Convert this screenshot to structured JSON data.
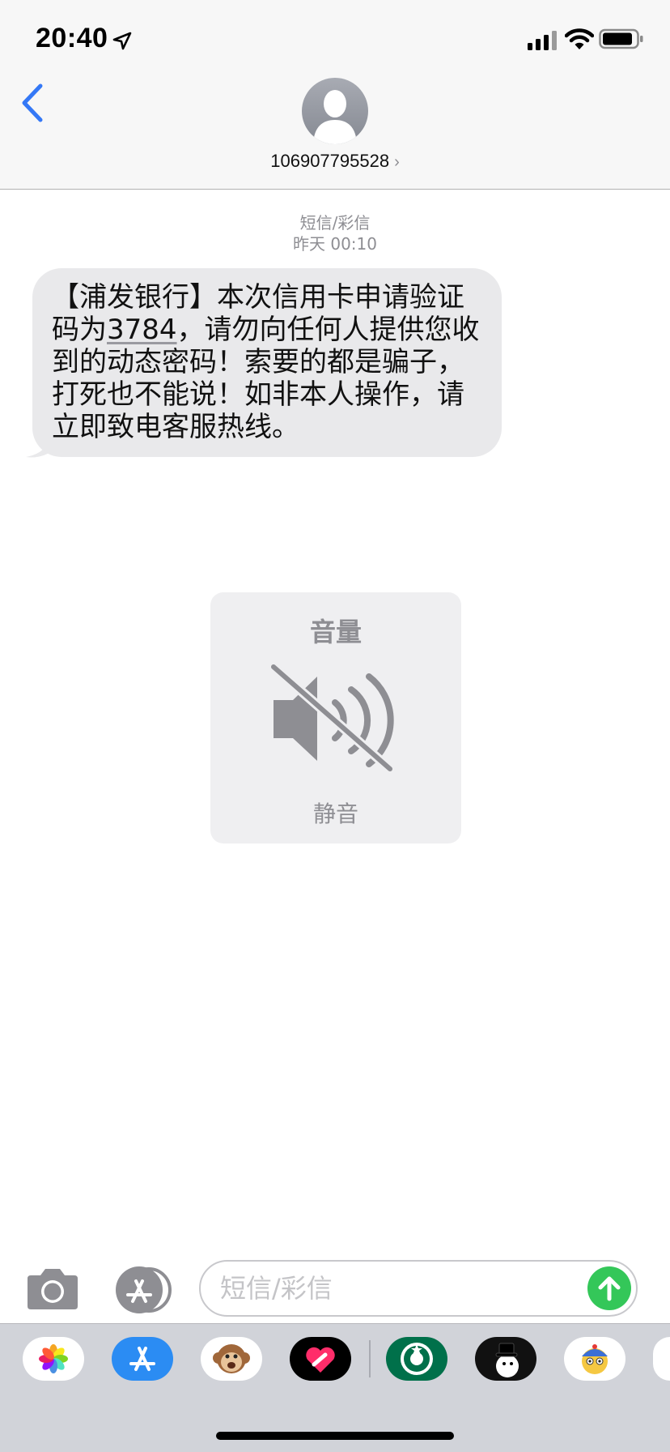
{
  "status_bar": {
    "time": "20:40",
    "icons": [
      "location-arrow-icon",
      "cellular-signal-icon",
      "wifi-icon",
      "battery-icon"
    ]
  },
  "header": {
    "back_icon": "chevron-left-icon",
    "avatar_icon": "person-silhouette-icon",
    "contact": "106907795528",
    "contact_chevron": "›"
  },
  "conversation": {
    "message_type": "短信/彩信",
    "timestamp": "昨天 00:10",
    "message": {
      "line1": "【浦发银行】本次信用卡申请验证",
      "line2_prefix": "码为",
      "code": "3784",
      "line2_suffix": "，请勿向任何人提供您收",
      "line3": "到的动态密码！索要的都是骗子，",
      "line4": "打死也不能说！如非本人操作，请",
      "line5": "立即致电客服热线。"
    }
  },
  "volume_hud": {
    "title": "音量",
    "icon": "speaker-muted-icon",
    "label": "静音"
  },
  "compose": {
    "camera_icon": "camera-icon",
    "apps_icon": "app-store-icon",
    "placeholder": "短信/彩信",
    "send_icon": "arrow-up-icon"
  },
  "app_drawer": {
    "apps": [
      "photos-icon",
      "app-store-icon",
      "animoji-monkey-icon",
      "digital-touch-icon",
      "starbucks-icon",
      "snowman-sticker-icon",
      "cartoon-sticker-icon"
    ]
  },
  "colors": {
    "accent": "#3478f6",
    "send": "#34c759",
    "bubble": "#e9e9eb",
    "header_bg": "#f7f7f7",
    "drawer_bg": "#d1d3d9"
  }
}
